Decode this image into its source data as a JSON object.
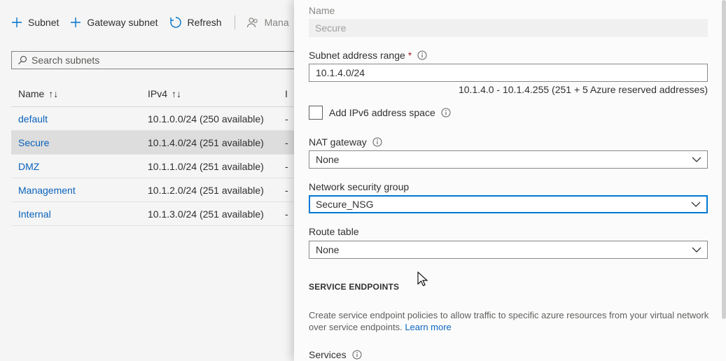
{
  "toolbar": {
    "subnet_label": "Subnet",
    "gateway_label": "Gateway subnet",
    "refresh_label": "Refresh",
    "manage_label": "Mana"
  },
  "search": {
    "placeholder": "Search subnets"
  },
  "table": {
    "headers": {
      "name": "Name",
      "ipv4": "IPv4",
      "third": "I"
    },
    "rows": [
      {
        "name": "default",
        "ipv4": "10.1.0.0/24 (250 available)",
        "third": "-"
      },
      {
        "name": "Secure",
        "ipv4": "10.1.4.0/24 (251 available)",
        "third": "-"
      },
      {
        "name": "DMZ",
        "ipv4": "10.1.1.0/24 (251 available)",
        "third": "-"
      },
      {
        "name": "Management",
        "ipv4": "10.1.2.0/24 (251 available)",
        "third": "-"
      },
      {
        "name": "Internal",
        "ipv4": "10.1.3.0/24 (251 available)",
        "third": "-"
      }
    ],
    "selected_row": "Secure"
  },
  "panel": {
    "name_label": "Name",
    "name_value": "Secure",
    "range_label": "Subnet address range",
    "required_mark": "*",
    "range_value": "10.1.4.0/24",
    "range_hint": "10.1.4.0 - 10.1.4.255 (251 + 5 Azure reserved addresses)",
    "ipv6_label": "Add IPv6 address space",
    "ipv6_checked": false,
    "nat_label": "NAT gateway",
    "nat_value": "None",
    "nsg_label": "Network security group",
    "nsg_value": "Secure_NSG",
    "route_label": "Route table",
    "route_value": "None",
    "service_endpoints_heading": "SERVICE ENDPOINTS",
    "service_desc": "Create service endpoint policies to allow traffic to specific azure resources from your virtual network over service endpoints.",
    "learn_more": "Learn more",
    "services_label": "Services"
  },
  "colors": {
    "accent": "#0078d4",
    "link": "#0a66c2",
    "required": "#a4262c"
  }
}
